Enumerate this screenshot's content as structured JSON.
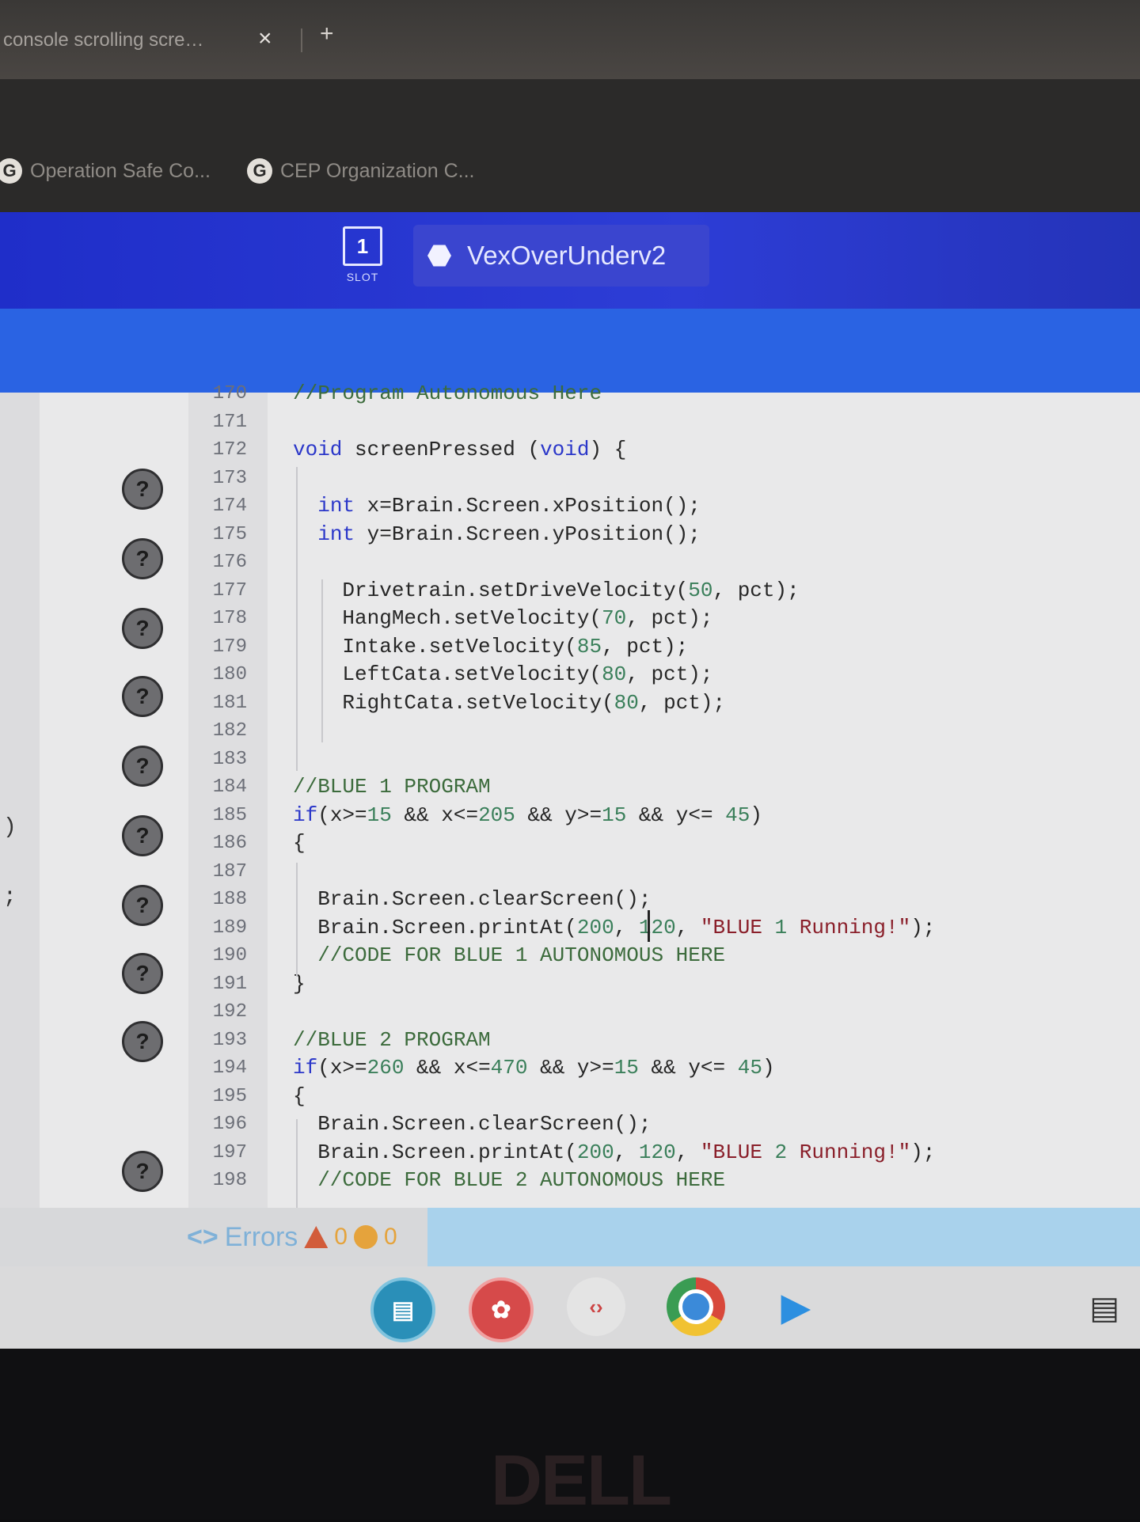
{
  "browser": {
    "tab_title": "console scrolling scre…",
    "tab_close": "×",
    "new_tab": "+",
    "bookmarks": [
      {
        "label": "Operation Safe Co...",
        "icon": "G"
      },
      {
        "label": "CEP Organization C...",
        "icon": "G"
      }
    ]
  },
  "app": {
    "slot_number": "1",
    "slot_label": "SLOT",
    "project_name": "VexOverUnderv2"
  },
  "editor": {
    "left_edge_fragments": [
      ")",
      ";"
    ],
    "lines": [
      {
        "n": "170",
        "text": "//Program Autonomous Here"
      },
      {
        "n": "171",
        "text": ""
      },
      {
        "n": "172",
        "text": "void screenPressed (void) {"
      },
      {
        "n": "173",
        "text": ""
      },
      {
        "n": "174",
        "text": "  int x=Brain.Screen.xPosition();"
      },
      {
        "n": "175",
        "text": "  int y=Brain.Screen.yPosition();"
      },
      {
        "n": "176",
        "text": ""
      },
      {
        "n": "177",
        "text": "    Drivetrain.setDriveVelocity(50, pct);"
      },
      {
        "n": "178",
        "text": "    HangMech.setVelocity(70, pct);"
      },
      {
        "n": "179",
        "text": "    Intake.setVelocity(85, pct);"
      },
      {
        "n": "180",
        "text": "    LeftCata.setVelocity(80, pct);"
      },
      {
        "n": "181",
        "text": "    RightCata.setVelocity(80, pct);"
      },
      {
        "n": "182",
        "text": ""
      },
      {
        "n": "183",
        "text": ""
      },
      {
        "n": "184",
        "text": "//BLUE 1 PROGRAM"
      },
      {
        "n": "185",
        "text": "if(x>=15 && x<=205 && y>=15 && y<= 45)"
      },
      {
        "n": "186",
        "text": "{"
      },
      {
        "n": "187",
        "text": ""
      },
      {
        "n": "188",
        "text": "  Brain.Screen.clearScreen();"
      },
      {
        "n": "189",
        "text": "  Brain.Screen.printAt(200, 120, \"BLUE 1 Running!\");"
      },
      {
        "n": "190",
        "text": "  //CODE FOR BLUE 1 AUTONOMOUS HERE"
      },
      {
        "n": "191",
        "text": "}"
      },
      {
        "n": "192",
        "text": ""
      },
      {
        "n": "193",
        "text": "//BLUE 2 PROGRAM"
      },
      {
        "n": "194",
        "text": "if(x>=260 && x<=470 && y>=15 && y<= 45)"
      },
      {
        "n": "195",
        "text": "{"
      },
      {
        "n": "196",
        "text": "  Brain.Screen.clearScreen();"
      },
      {
        "n": "197",
        "text": "  Brain.Screen.printAt(200, 120, \"BLUE 2 Running!\");"
      },
      {
        "n": "198",
        "text": "  //CODE FOR BLUE 2 AUTONOMOUS HERE"
      }
    ],
    "help_glyph": "?"
  },
  "errors": {
    "icon": "<>",
    "label": "Errors",
    "warning_count": "0",
    "error_count": "0"
  },
  "shelf": {
    "apps": [
      {
        "name": "classroom-app",
        "color": "#2a8fb8"
      },
      {
        "name": "chat-app",
        "color": "#d64a4a"
      },
      {
        "name": "code-app",
        "color": "#e4e4e4"
      },
      {
        "name": "chrome-app",
        "color": "#3b8ad9"
      },
      {
        "name": "play-store-app",
        "color": "#dadadb"
      }
    ]
  },
  "device": {
    "brand": "DELL"
  },
  "colors": {
    "accent_blue": "#2d3dd6",
    "keyword": "#2b37c9",
    "comment": "#3c6b3c",
    "string": "#8a1f2a"
  }
}
